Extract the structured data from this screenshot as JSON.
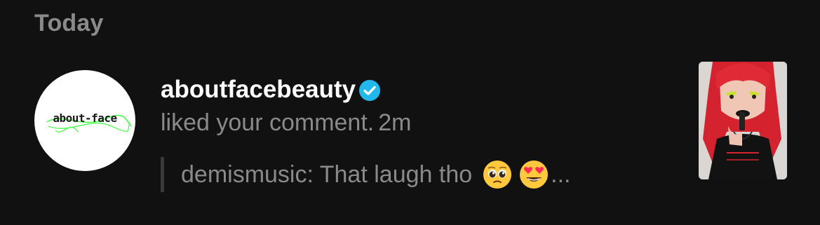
{
  "section": {
    "label": "Today"
  },
  "notification": {
    "avatar_text": "about-face",
    "avatar_icon": "about-face-logo",
    "username": "aboutfacebeauty",
    "verified_icon": "verified-badge-icon",
    "action": "liked your comment.",
    "time": "2m",
    "quote": {
      "author": "demismusic",
      "text": "demismusic: That laugh tho",
      "emojis": [
        "pleading-face-emoji",
        "heart-eyes-emoji"
      ],
      "ellipsis": "..."
    },
    "thumbnail_icon": "video-thumbnail"
  },
  "colors": {
    "background": "#111111",
    "primary_text": "#ffffff",
    "secondary_text": "#8a8a8a",
    "verified": "#20b8ed",
    "logo_accent": "#3dff3d"
  }
}
